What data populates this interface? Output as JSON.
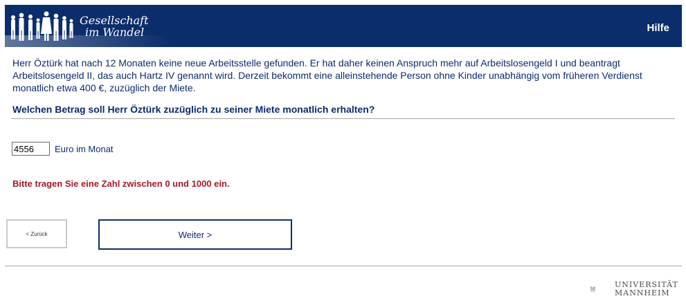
{
  "header": {
    "logo_line1": "Gesellschaft",
    "logo_line2": "im Wandel",
    "help_label": "Hilfe",
    "background_color": "#0b2d6b"
  },
  "intro_text": "Herr Öztürk hat nach 12 Monaten keine neue Arbeitsstelle gefunden. Er hat daher keinen Anspruch mehr auf Arbeitslosengeld I und beantragt Arbeitslosengeld II, das auch Hartz IV genannt wird. Derzeit bekommt eine alleinstehende Person ohne Kinder unabhängig vom früheren Verdienst monatlich etwa 400 €, zuzüglich der Miete.",
  "question": "Welchen Betrag soll Herr Öztürk zuzüglich zu seiner Miete monatlich erhalten?",
  "answer": {
    "value": "4556",
    "unit_label": "Euro im Monat"
  },
  "error_message": "Bitte tragen Sie eine Zahl zwischen 0 und 1000 ein.",
  "navigation": {
    "back_label": "< Zurück",
    "next_label": "Weiter >"
  },
  "footer": {
    "university_line1": "UNIVERSITÄT",
    "university_line2": "MANNHEIM"
  },
  "colors": {
    "text": "#0b2b6b",
    "error": "#a11a2a",
    "accent": "#0b2d6b"
  }
}
